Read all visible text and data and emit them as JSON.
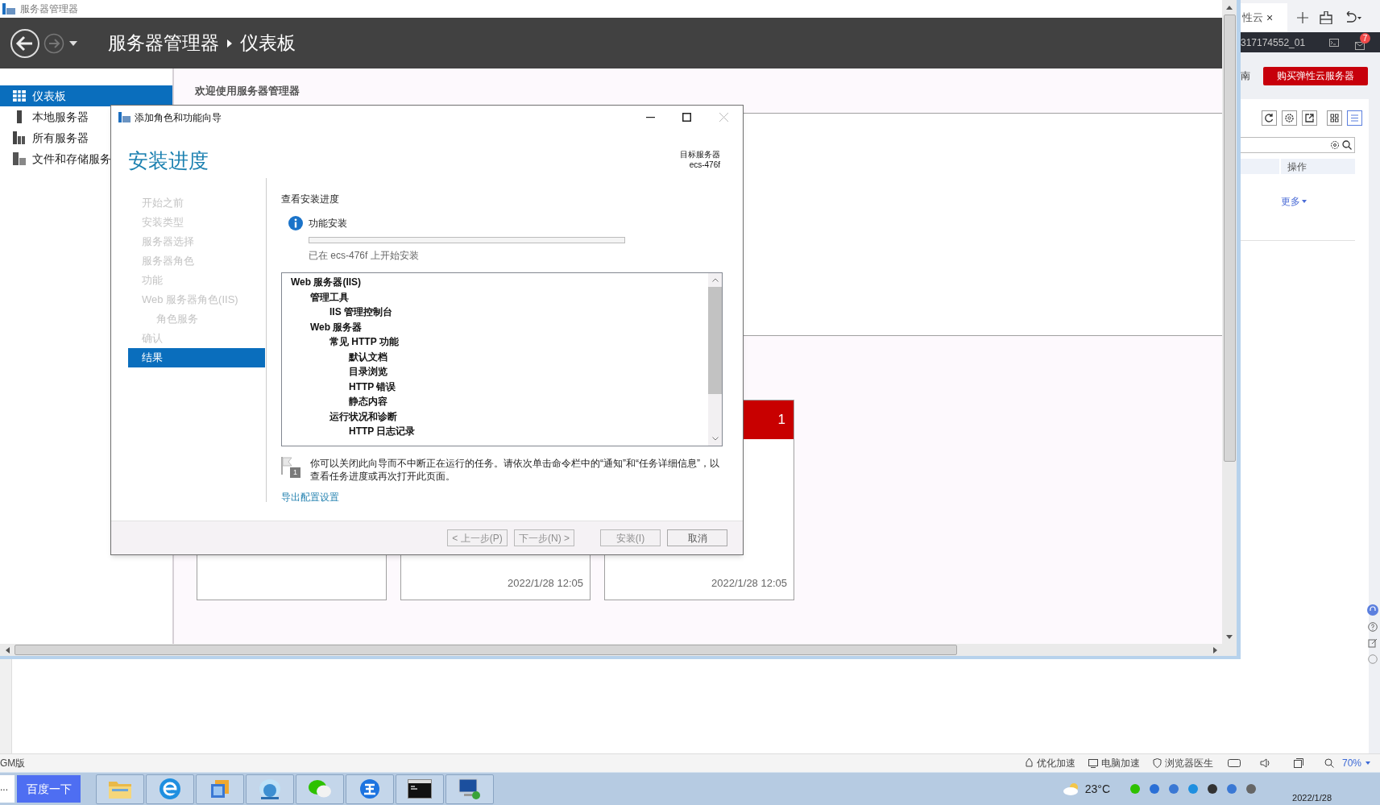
{
  "server_manager": {
    "window_title": "服务器管理器",
    "breadcrumb": [
      "服务器管理器",
      "仪表板"
    ],
    "sidebar": [
      {
        "label": "仪表板",
        "selected": true,
        "kind": "dashboard"
      },
      {
        "label": "本地服务器",
        "selected": false,
        "kind": "server"
      },
      {
        "label": "所有服务器",
        "selected": false,
        "kind": "servers"
      },
      {
        "label": "文件和存储服务",
        "selected": false,
        "kind": "storage"
      }
    ],
    "welcome": "欢迎使用服务器管理器",
    "cards": [
      {
        "kind": "plain"
      },
      {
        "kind": "plain",
        "time": "2022/1/28 12:05"
      },
      {
        "kind": "alert",
        "count": "1",
        "time": "2022/1/28 12:05"
      }
    ]
  },
  "wizard": {
    "title": "添加角色和功能向导",
    "heading": "安装进度",
    "target_label": "目标服务器",
    "target_name": "ecs-476f",
    "steps": [
      {
        "label": "开始之前",
        "selected": false
      },
      {
        "label": "安装类型",
        "selected": false
      },
      {
        "label": "服务器选择",
        "selected": false
      },
      {
        "label": "服务器角色",
        "selected": false
      },
      {
        "label": "功能",
        "selected": false
      },
      {
        "label": "Web 服务器角色(IIS)",
        "selected": false,
        "children": [
          {
            "label": "角色服务",
            "selected": false
          }
        ]
      },
      {
        "label": "确认",
        "selected": false
      },
      {
        "label": "结果",
        "selected": true
      }
    ],
    "section_title": "查看安装进度",
    "task": {
      "label": "功能安装",
      "level": 0,
      "status": "已在 ecs-476f 上开始安装"
    },
    "features": [
      {
        "label": "Web 服务器(IIS)",
        "children": [
          {
            "label": "管理工具",
            "children": [
              {
                "label": "IIS 管理控制台"
              }
            ]
          },
          {
            "label": "Web 服务器",
            "children": [
              {
                "label": "常见 HTTP 功能",
                "children": [
                  {
                    "label": "默认文档"
                  },
                  {
                    "label": "目录浏览"
                  },
                  {
                    "label": "HTTP 错误"
                  },
                  {
                    "label": "静态内容"
                  }
                ]
              },
              {
                "label": "运行状况和诊断",
                "children": [
                  {
                    "label": "HTTP 日志记录"
                  }
                ]
              }
            ]
          }
        ]
      }
    ],
    "note": "你可以关闭此向导而不中断正在运行的任务。请依次单击命令栏中的“通知”和“任务详细信息”，以查看任务进度或再次打开此页面。",
    "note_badge": "1",
    "link": "导出配置设置",
    "buttons": [
      {
        "label": "< 上一步(P)",
        "disabled": true
      },
      {
        "label": "下一步(N) >",
        "disabled": true
      },
      {
        "label": "安装(I)",
        "disabled": true
      },
      {
        "label": "取消",
        "disabled": false
      }
    ]
  },
  "browser": {
    "tab": "性云",
    "tab_close": "×",
    "account": "317174552_01",
    "badge": "7",
    "guide_text": "南",
    "buy_button": "购买弹性云服务器",
    "column": "操作",
    "more": "更多",
    "status_left": "GM版",
    "status_items": [
      "优化加速",
      "电脑加速",
      "浏览器医生"
    ],
    "zoom": "70%"
  },
  "taskbar": {
    "search_text": "...",
    "search_button": "百度一下",
    "apps": [
      {
        "kind": "folder"
      },
      {
        "kind": "ie"
      },
      {
        "kind": "windows"
      },
      {
        "kind": "penguin"
      },
      {
        "kind": "chat"
      },
      {
        "kind": "wang"
      },
      {
        "kind": "cmd"
      },
      {
        "kind": "network"
      }
    ],
    "temperature": "23°C",
    "date": "2022/1/28"
  }
}
